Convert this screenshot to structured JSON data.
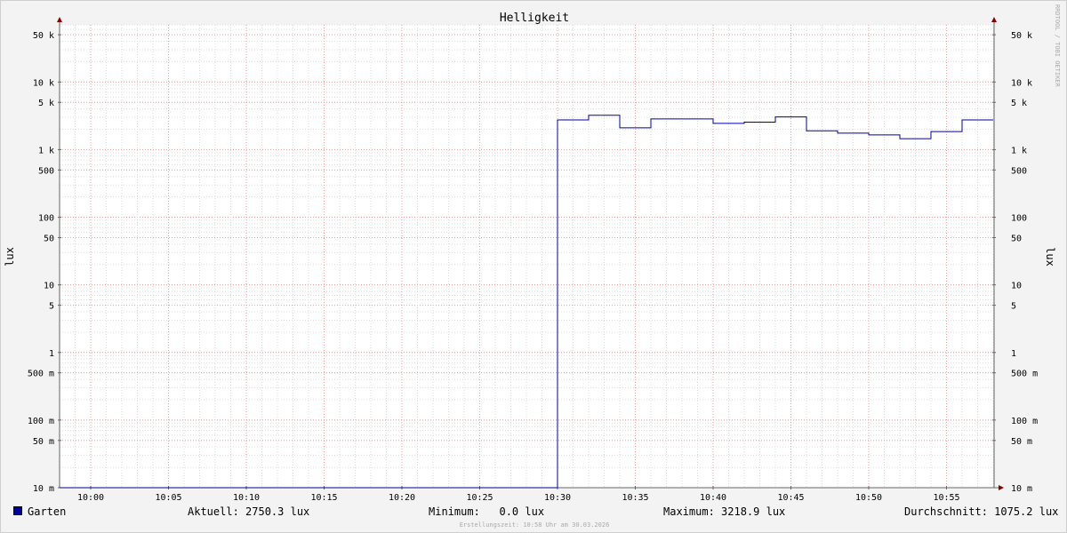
{
  "chart_data": {
    "type": "line",
    "title": "Helligkeit",
    "ylabel": "lux",
    "y_scale": "log",
    "ylim": [
      0.01,
      70000
    ],
    "y_ticks": [
      {
        "value": 50000,
        "label": "50 k"
      },
      {
        "value": 10000,
        "label": "10 k"
      },
      {
        "value": 5000,
        "label": "5 k"
      },
      {
        "value": 1000,
        "label": "1 k"
      },
      {
        "value": 500,
        "label": "500"
      },
      {
        "value": 100,
        "label": "100"
      },
      {
        "value": 50,
        "label": "50"
      },
      {
        "value": 10,
        "label": "10"
      },
      {
        "value": 5,
        "label": "5"
      },
      {
        "value": 1,
        "label": "1"
      },
      {
        "value": 0.5,
        "label": "500 m"
      },
      {
        "value": 0.1,
        "label": "100 m"
      },
      {
        "value": 0.05,
        "label": "50 m"
      },
      {
        "value": 0.01,
        "label": "10 m"
      }
    ],
    "xlim": [
      "09:58",
      "11:58"
    ],
    "x_ticks": [
      "10:00",
      "10:05",
      "10:10",
      "10:15",
      "10:20",
      "10:25",
      "10:30",
      "10:35",
      "10:40",
      "10:45",
      "10:50",
      "10:55"
    ],
    "grid": true,
    "series": [
      {
        "name": "Garten",
        "color": "#0000a0",
        "step": true,
        "points": [
          {
            "x": "09:58",
            "y": 0
          },
          {
            "x": "10:30",
            "y": 2750
          },
          {
            "x": "10:32",
            "y": 3218.9
          },
          {
            "x": "10:34",
            "y": 2100
          },
          {
            "x": "10:36",
            "y": 2850
          },
          {
            "x": "10:40",
            "y": 2450
          },
          {
            "x": "10:42",
            "y": 2550
          },
          {
            "x": "10:44",
            "y": 3050
          },
          {
            "x": "10:46",
            "y": 1900
          },
          {
            "x": "10:48",
            "y": 1750
          },
          {
            "x": "10:50",
            "y": 1650
          },
          {
            "x": "10:52",
            "y": 1450
          },
          {
            "x": "10:54",
            "y": 1850
          },
          {
            "x": "10:56",
            "y": 2750.3
          }
        ]
      }
    ],
    "legend": {
      "name": "Garten",
      "current": "Aktuell: 2750.3 lux",
      "minimum": "Minimum:   0.0 lux",
      "maximum": "Maximum: 3218.9 lux",
      "average": "Durchschnitt: 1075.2 lux"
    },
    "credit": "Erstellungszeit: 10:58 Uhr am 30.03.2026",
    "watermark": "RRDTOOL / TOBI OETIKER"
  },
  "colors": {
    "background": "#f3f3f3",
    "plot_background": "#ffffff",
    "grid_minor": "#dddddd",
    "grid_major": "#e8a0a0",
    "axis": "#666666",
    "series": "#0000a0",
    "arrow": "#880000"
  }
}
